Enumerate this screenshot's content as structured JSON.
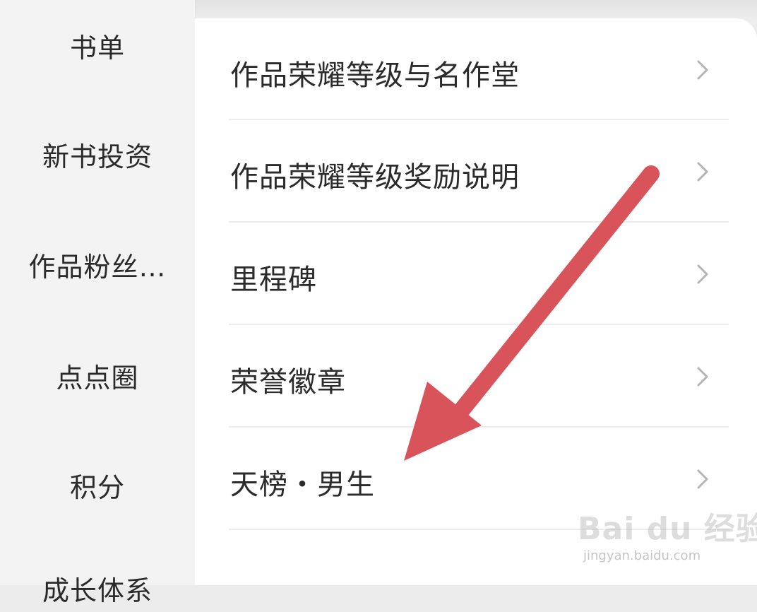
{
  "sidebar": {
    "items": [
      {
        "label": "书单"
      },
      {
        "label": "新书投资"
      },
      {
        "label": "作品粉丝…"
      },
      {
        "label": "点点圈"
      },
      {
        "label": "积分"
      },
      {
        "label": "成长体系"
      }
    ]
  },
  "menu": {
    "items": [
      {
        "label": "作品荣耀等级与名作堂",
        "icon": "chevron-right-icon"
      },
      {
        "label": "作品荣耀等级奖励说明",
        "icon": "chevron-right-icon"
      },
      {
        "label": "里程碑",
        "icon": "chevron-right-icon"
      },
      {
        "label": "荣誉徽章",
        "icon": "chevron-right-icon"
      },
      {
        "label": "天榜・男生",
        "icon": "chevron-right-icon"
      }
    ]
  },
  "annotation": {
    "arrow_color": "#d9535b"
  },
  "watermark": {
    "logo_text": "Bai du 经验",
    "url": "jingyan.baidu.com"
  }
}
